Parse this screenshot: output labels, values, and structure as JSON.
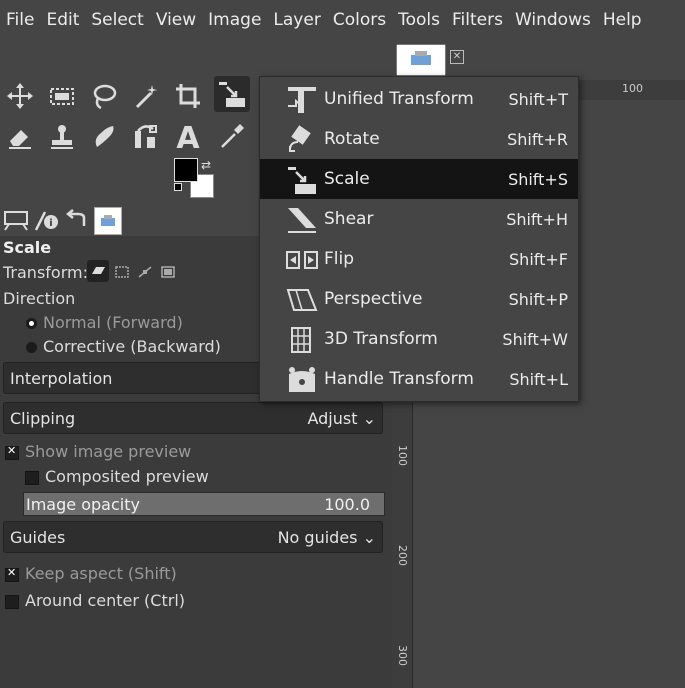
{
  "menubar": [
    "File",
    "Edit",
    "Select",
    "View",
    "Image",
    "Layer",
    "Colors",
    "Tools",
    "Filters",
    "Windows",
    "Help"
  ],
  "transform_menu": [
    {
      "label": "Unified Transform",
      "shortcut": "Shift+T",
      "icon": "unified-transform-icon"
    },
    {
      "label": "Rotate",
      "shortcut": "Shift+R",
      "icon": "rotate-icon"
    },
    {
      "label": "Scale",
      "shortcut": "Shift+S",
      "icon": "scale-icon",
      "selected": true
    },
    {
      "label": "Shear",
      "shortcut": "Shift+H",
      "icon": "shear-icon"
    },
    {
      "label": "Flip",
      "shortcut": "Shift+F",
      "icon": "flip-icon"
    },
    {
      "label": "Perspective",
      "shortcut": "Shift+P",
      "icon": "perspective-icon"
    },
    {
      "label": "3D Transform",
      "shortcut": "Shift+W",
      "icon": "3d-transform-icon"
    },
    {
      "label": "Handle Transform",
      "shortcut": "Shift+L",
      "icon": "handle-transform-icon"
    }
  ],
  "tool_options": {
    "title": "Scale",
    "transform_label": "Transform:",
    "direction_label": "Direction",
    "direction_normal": "Normal (Forward)",
    "direction_corrective": "Corrective (Backward)",
    "interpolation_label": "Interpolation",
    "clipping_label": "Clipping",
    "clipping_value": "Adjust",
    "show_preview": "Show image preview",
    "composited_preview": "Composited preview",
    "opacity_label": "Image opacity",
    "opacity_value": "100.0",
    "guides_label": "Guides",
    "guides_value": "No guides",
    "keep_aspect": "Keep aspect (Shift)",
    "around_center": "Around center (Ctrl)"
  },
  "ruler": {
    "h_label": "100",
    "v_labels": [
      "100",
      "200",
      "300"
    ]
  },
  "colors": {
    "bg": "#454545",
    "panel": "#3b3b3b",
    "menu_selected": "#141414",
    "foreground": "#000000",
    "background": "#ffffff"
  }
}
